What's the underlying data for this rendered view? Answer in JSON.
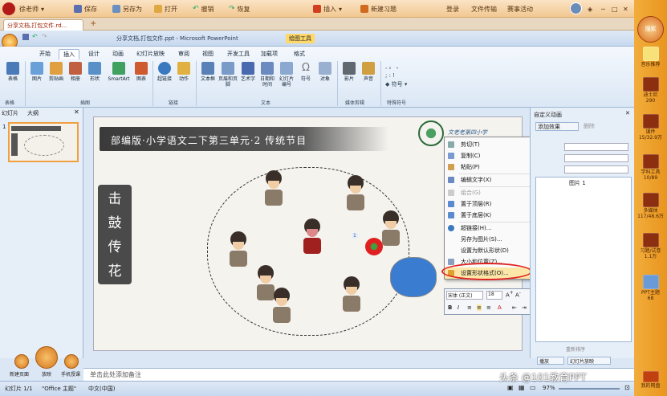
{
  "topbar": {
    "app_name": "徐老师",
    "save": "保存",
    "save_as": "另存为",
    "open": "打开",
    "undo": "撤销",
    "redo": "恢复",
    "insert": "插入",
    "new_item": "新建习题",
    "login": "登录",
    "file_transfer": "文件传输",
    "event": "赛事活动"
  },
  "doc_tab": "分享文档,打包文件.rd...",
  "ppt_title": "分享文档,打包文件.ppt - Microsoft PowerPoint",
  "drawing_tools": "绘图工具",
  "ribbon": {
    "tabs": [
      "开始",
      "插入",
      "设计",
      "动画",
      "幻灯片放映",
      "审阅",
      "视图",
      "开发工具",
      "加载项",
      "格式"
    ],
    "active_tab": "插入",
    "buttons": [
      "表格",
      "图片",
      "剪贴画",
      "相册",
      "形状",
      "SmartArt",
      "图表",
      "超链接",
      "动作",
      "文本框",
      "页眉和页脚",
      "艺术字",
      "日期和时间",
      "幻灯片编号",
      "符号",
      "对象",
      "影片",
      "声音"
    ],
    "groups": [
      "表格",
      "插图",
      "链接",
      "文本",
      "媒体剪辑",
      "特殊符号"
    ]
  },
  "left_panel": {
    "tab_slides": "幻灯片",
    "tab_outline": "大纲",
    "slide_number": "1"
  },
  "slide": {
    "title": "部编版·小学语文二下第三单元·2 传统节目",
    "logo_text": "文老老第四小学",
    "vertical_title": [
      "击",
      "鼓",
      "传",
      "花"
    ],
    "label_1": "1"
  },
  "context_menu": {
    "items": [
      {
        "label": "剪切(T)",
        "disabled": false
      },
      {
        "label": "复制(C)",
        "disabled": false
      },
      {
        "label": "粘贴(P)",
        "disabled": false
      },
      {
        "label": "编辑文字(X)",
        "disabled": false
      },
      {
        "label": "组合(G)",
        "disabled": true
      },
      {
        "label": "置于顶层(R)",
        "disabled": false
      },
      {
        "label": "置于底层(K)",
        "disabled": false
      },
      {
        "label": "超链接(H)...",
        "disabled": false
      },
      {
        "label": "另存为图片(S)...",
        "disabled": false
      },
      {
        "label": "设置为默认形状(D)",
        "disabled": false
      },
      {
        "label": "大小和位置(Z)...",
        "disabled": false
      },
      {
        "label": "设置形状格式(O)...",
        "disabled": false
      }
    ]
  },
  "mini_toolbar": {
    "font": "宋体 (正文)",
    "size": "18"
  },
  "task_pane": {
    "title": "自定义动画",
    "add_effect": "添加效果",
    "remove": "删除",
    "item_label": "图片 1",
    "reorder": "重新排序",
    "play": "播放",
    "slideshow": "幻灯片放映"
  },
  "notes_placeholder": "单击此处添加备注",
  "status": {
    "slide_info": "幻灯片 1/1",
    "theme": "\"Office 主题\"",
    "language": "中文(中国)",
    "zoom": "97%"
  },
  "bottom_tools": {
    "new_page": "新建页面",
    "play": "放映",
    "mobile": "手机授课"
  },
  "right_sidebar": {
    "search": "搜索",
    "items": [
      {
        "label": "音乐推荐",
        "count": ""
      },
      {
        "label": "迪士尼",
        "count": "290"
      },
      {
        "label": "课件",
        "count": "15/32.9万"
      },
      {
        "label": "学科工具",
        "count": "10/89"
      },
      {
        "label": "多媒体",
        "count": "117/48.6万"
      },
      {
        "label": "习题/试卷",
        "count": "1.1万"
      },
      {
        "label": "PPT主题",
        "count": "68"
      },
      {
        "label": "我的网盘",
        "count": ""
      }
    ]
  },
  "watermark": "头条 @101教育PPT"
}
